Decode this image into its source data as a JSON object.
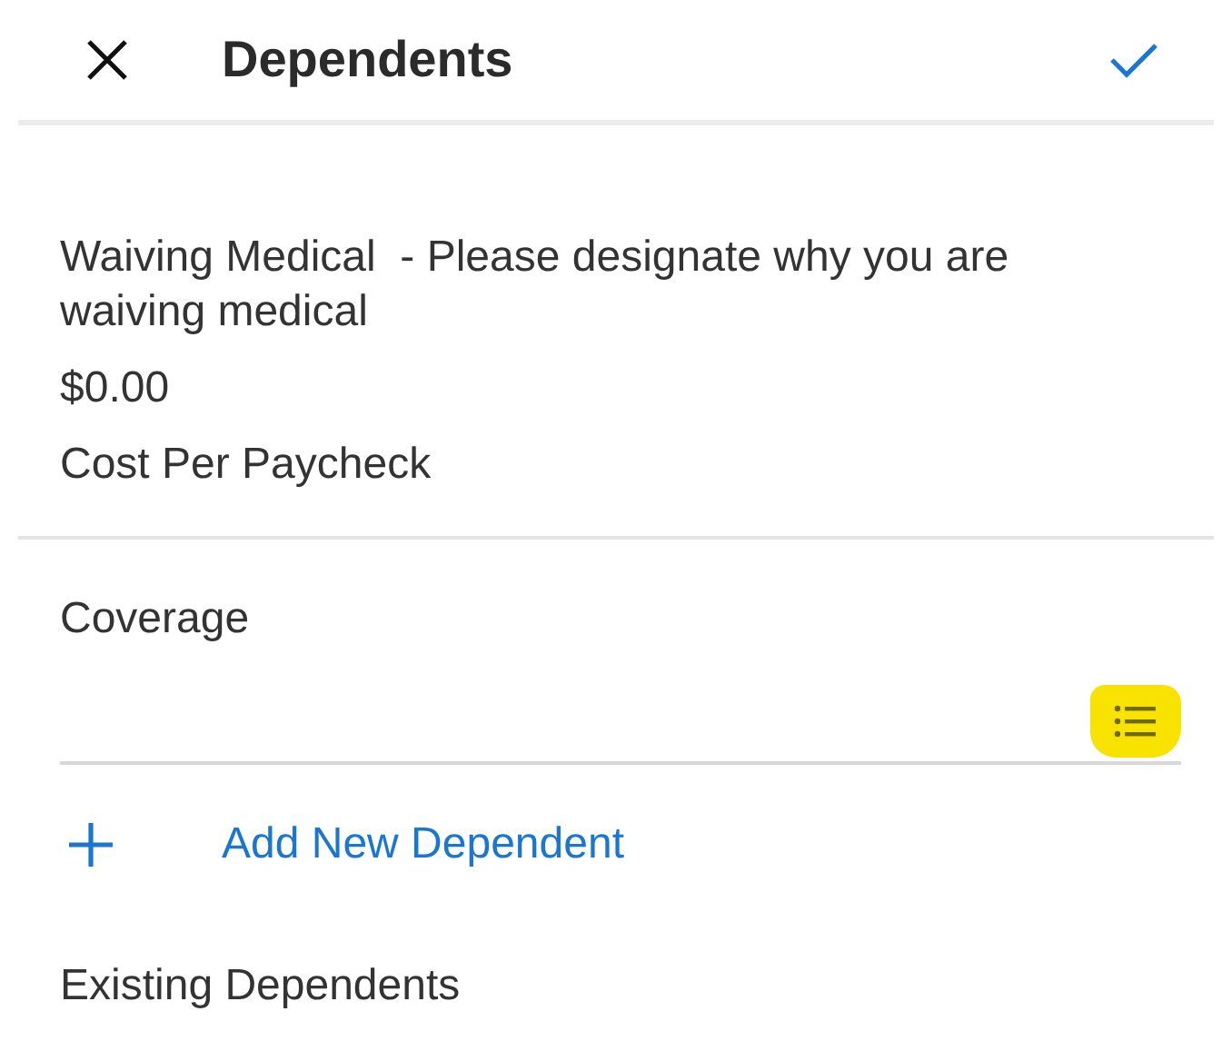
{
  "header": {
    "title": "Dependents"
  },
  "plan": {
    "description": "Waiving Medical  - Please designate why you are waiving medical",
    "cost": "$0.00",
    "cost_label": "Cost Per Paycheck"
  },
  "coverage": {
    "label": "Coverage"
  },
  "add_link": {
    "label": "Add New Dependent"
  },
  "existing": {
    "label": "Existing Dependents"
  }
}
